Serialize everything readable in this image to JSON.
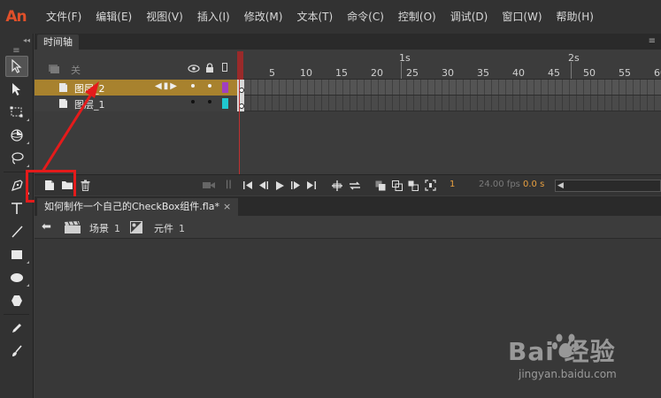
{
  "app": {
    "logo": "An"
  },
  "menu": [
    "文件(F)",
    "编辑(E)",
    "视图(V)",
    "插入(I)",
    "修改(M)",
    "文本(T)",
    "命令(C)",
    "控制(O)",
    "调试(D)",
    "窗口(W)",
    "帮助(H)"
  ],
  "timeline": {
    "tab_label": "时间轴",
    "header_label": "关",
    "seconds": [
      "1s",
      "2s"
    ],
    "frame_numbers": [
      "1",
      "5",
      "10",
      "15",
      "20",
      "25",
      "30",
      "35",
      "40",
      "45",
      "50",
      "55",
      "60"
    ],
    "layers": [
      {
        "name": "图层_2",
        "color": "#a040c0",
        "selected": true
      },
      {
        "name": "图层_1",
        "color": "#20c8d0",
        "selected": false
      }
    ],
    "current_frame": "1",
    "fps": "24.00 fps",
    "time": "0.0 s"
  },
  "document": {
    "tab_title": "如何制作一个自己的CheckBox组件.fla*",
    "close_label": "×",
    "scene_label": "场景",
    "scene_number": "1",
    "symbol_label": "元件",
    "symbol_number": "1"
  },
  "watermark": {
    "brand": "Bai 经验",
    "url": "jingyan.baidu.com"
  },
  "colors": {
    "highlight": "#e41b1b",
    "selected_layer": "#a8822e",
    "playhead": "#c03030"
  }
}
